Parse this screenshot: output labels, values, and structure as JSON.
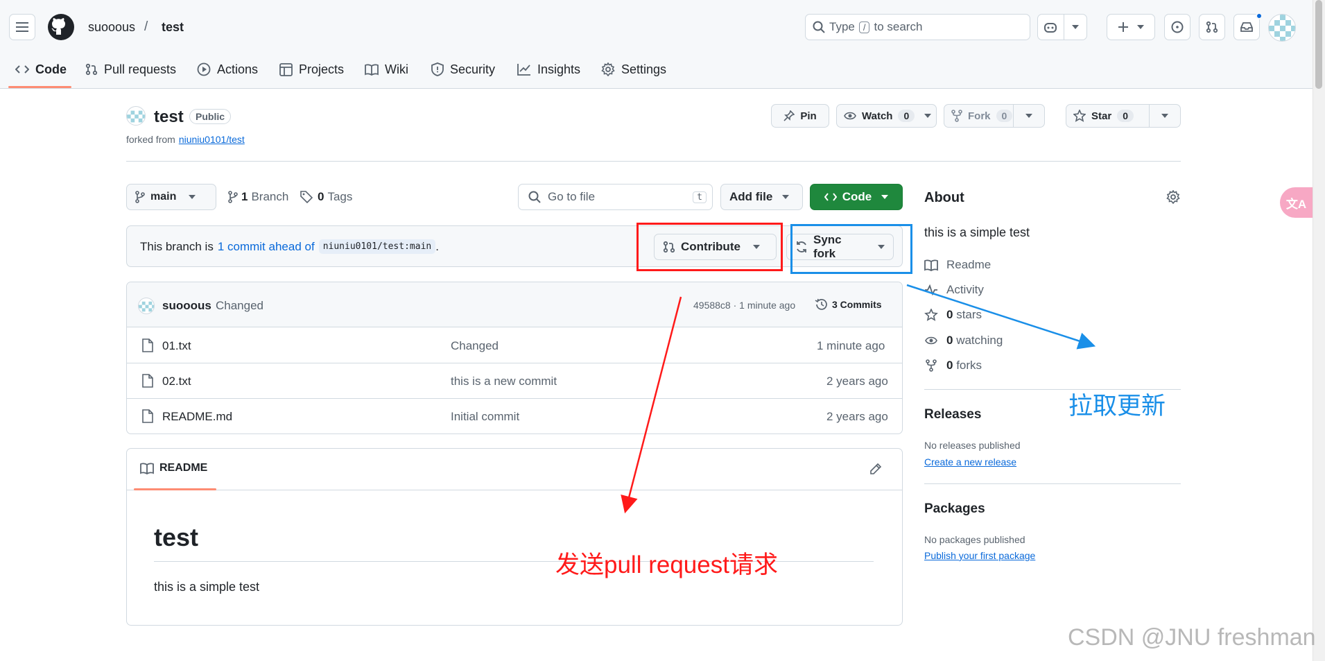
{
  "header": {
    "owner": "suooous",
    "separator": "/",
    "repo": "test",
    "search_placeholder_a": "Type",
    "search_key": "/",
    "search_placeholder_b": "to search"
  },
  "tabs": [
    {
      "label": "Code",
      "icon": "code-icon",
      "active": true
    },
    {
      "label": "Pull requests",
      "icon": "pull-request-icon"
    },
    {
      "label": "Actions",
      "icon": "play-icon"
    },
    {
      "label": "Projects",
      "icon": "table-icon"
    },
    {
      "label": "Wiki",
      "icon": "book-icon"
    },
    {
      "label": "Security",
      "icon": "shield-icon"
    },
    {
      "label": "Insights",
      "icon": "graph-icon"
    },
    {
      "label": "Settings",
      "icon": "gear-icon"
    }
  ],
  "repo_header": {
    "name": "test",
    "visibility": "Public",
    "forked_prefix": "forked from",
    "forked_source": "niuniu0101/test",
    "pin": "Pin",
    "watch": "Watch",
    "watch_count": "0",
    "fork": "Fork",
    "fork_count": "0",
    "star": "Star",
    "star_count": "0"
  },
  "toolbar": {
    "branch": "main",
    "branch_count": "1",
    "branch_label": "Branch",
    "tag_count": "0",
    "tag_label": "Tags",
    "go_to_file": "Go to file",
    "go_to_file_key": "t",
    "add_file": "Add file",
    "code": "Code"
  },
  "ahead_banner": {
    "prefix": "This branch is",
    "link": "1 commit ahead of",
    "ref": "niuniu0101/test:main",
    "suffix": ".",
    "contribute": "Contribute",
    "sync_fork": "Sync fork"
  },
  "latest_commit": {
    "author": "suooous",
    "message": "Changed",
    "sha_time": "49588c8 · 1 minute ago",
    "commits": "3 Commits"
  },
  "files": [
    {
      "name": "01.txt",
      "message": "Changed",
      "time": "1 minute ago"
    },
    {
      "name": "02.txt",
      "message": "this is a new commit",
      "time": "2 years ago"
    },
    {
      "name": "README.md",
      "message": "Initial commit",
      "time": "2 years ago"
    }
  ],
  "readme": {
    "tab": "README",
    "title": "test",
    "body": "this is a simple test"
  },
  "about": {
    "heading": "About",
    "description": "this is a simple test",
    "readme": "Readme",
    "activity": "Activity",
    "stars_count": "0",
    "stars": "stars",
    "watching_count": "0",
    "watching": "watching",
    "forks_count": "0",
    "forks": "forks",
    "releases_heading": "Releases",
    "releases_empty": "No releases published",
    "releases_link": "Create a new release",
    "packages_heading": "Packages",
    "packages_empty": "No packages published",
    "packages_link": "Publish your first package"
  },
  "annotations": {
    "pull_request_note": "发送pull request请求",
    "sync_note": "拉取更新",
    "watermark": "CSDN @JNU freshman",
    "translate_badge": "文A"
  },
  "colors": {
    "primary_green": "#1f883d",
    "link_blue": "#0969da",
    "annotation_red": "#ff1a1a",
    "annotation_blue": "#1a8fe8",
    "active_tab": "#fd8c73"
  }
}
